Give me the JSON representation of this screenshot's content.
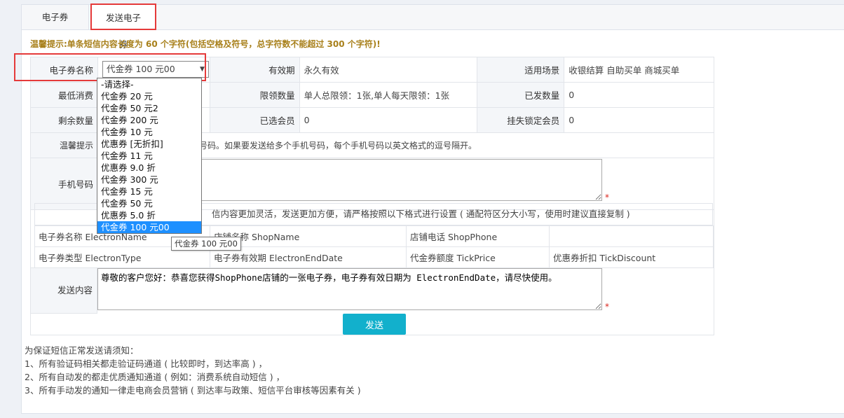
{
  "tabs": [
    {
      "label": "电子券"
    },
    {
      "label": "发送电子券"
    }
  ],
  "notice": "温馨提示:单条短信内容长度为 60 个字符(包括空格及符号，总字符数不能超过 300 个字符)!",
  "form": {
    "voucher_name_label": "电子券名称",
    "voucher_name_value": "代金券 100 元00",
    "validity_label": "有效期",
    "validity_value": "永久有效",
    "scene_label": "适用场景",
    "scene_value": "收银结算 自助买单 商城买单",
    "min_spend_label": "最低消费",
    "limit_label": "限领数量",
    "limit_value": "单人总限领：1张,单人每天限领：1张",
    "issued_label": "已发数量",
    "issued_value": "0",
    "remaining_label": "剩余数量",
    "selected_members_label": "已选会员",
    "selected_members_value": "0",
    "lost_members_label": "挂失锁定会员",
    "lost_members_value": "0",
    "tip_label": "温馨提示",
    "tip_text": "送的手机号码。如果要发送给多个手机号码，每个手机号码以英文格式的逗号隔开。",
    "phone_label": "手机号码",
    "phone_value": "",
    "content_label": "发送内容",
    "content_value": "尊敬的客户您好：恭喜您获得ShopPhone店铺的一张电子券，电子券有效日期为 ElectronEndDate，请尽快使用。",
    "required_mark": "*",
    "send_button": "发送"
  },
  "dropdown": {
    "options": [
      "-请选择-",
      "代金券 20 元",
      "代金券 50 元2",
      "代金券 200 元",
      "代金券 10 元",
      "优惠券 [无折扣]",
      "代金券 11 元",
      "优惠券 9.0 折",
      "代金券 300 元",
      "代金券 15 元",
      "代金券 50 元",
      "优惠券 5.0 折",
      "代金券 100 元00"
    ],
    "selected_index": 12,
    "tooltip": "代金券 100 元00"
  },
  "hint_text": "信内容更加灵活，发送更加方便，请严格按照以下格式进行设置 ( 通配符区分大小写，使用时建议直接复制 )",
  "variables": [
    [
      "电子券名称 ElectronName",
      "店铺名称 ShopName",
      "店铺电话 ShopPhone",
      ""
    ],
    [
      "电子券类型 ElectronType",
      "电子券有效期 ElectronEndDate",
      "代金券额度 TickPrice",
      "优惠券折扣 TickDiscount"
    ]
  ],
  "footer": [
    "为保证短信正常发送请须知：",
    "1、所有验证码相关都走验证码通道 ( 比较即时，到达率高 ) ，",
    "2、所有自动发的都走优质通知通道 ( 例如：消费系统自动短信 ) ，",
    "3、所有手动发的通知一律走电商会员营销 ( 到达率与政策、短信平台审核等因素有关 )"
  ],
  "colors": {
    "accent": "#12b0cc",
    "highlight_border": "#e53a3a",
    "notice": "#a8801b",
    "tip_red": "#d9251c",
    "selected_option": "#1e90ff"
  }
}
